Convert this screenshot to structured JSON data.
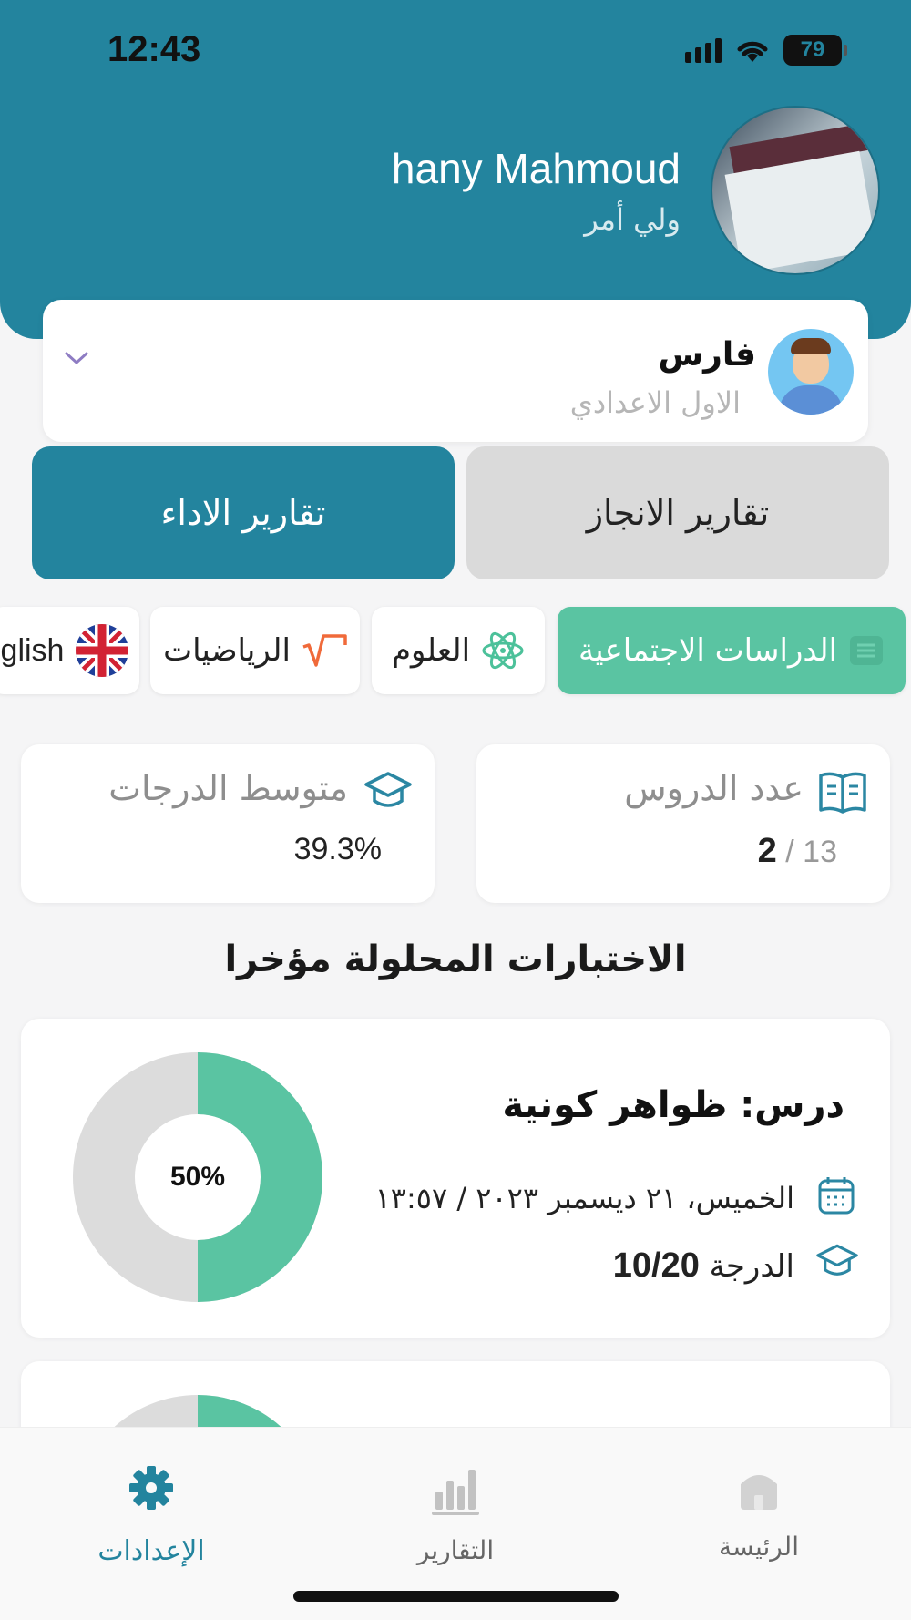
{
  "status_bar": {
    "time": "12:43",
    "battery": "79"
  },
  "profile": {
    "name": "hany Mahmoud",
    "role": "ولي أمر"
  },
  "student": {
    "name": "فارس",
    "grade": "الاول الاعدادي"
  },
  "tabs": {
    "achievement": "تقارير الانجاز",
    "performance": "تقارير الاداء"
  },
  "subjects": [
    {
      "label": "الدراسات الاجتماعية",
      "icon": "list-icon",
      "selected": true
    },
    {
      "label": "العلوم",
      "icon": "atom-icon",
      "selected": false
    },
    {
      "label": "الرياضيات",
      "icon": "sqrt-icon",
      "selected": false
    },
    {
      "label": "glish",
      "icon": "uk-flag-icon",
      "selected": false
    }
  ],
  "stats": {
    "lessons": {
      "label": "عدد الدروس",
      "done": "2",
      "total": "13",
      "sep": "/"
    },
    "average": {
      "label": "متوسط الدرجات",
      "value": "39.3%"
    }
  },
  "recent_quizzes_title": "الاختبارات المحلولة مؤخرا",
  "quizzes": [
    {
      "title": "درس: ظواهر كونية",
      "date": "الخميس، ٢١ ديسمبر ٢٠٢٣ / ١٣:٥٧",
      "grade_label": "الدرجة",
      "grade": "10/20",
      "percent_label": "50%",
      "percent": 50
    }
  ],
  "colors": {
    "primary": "#23849e",
    "accent_green": "#5ac4a2",
    "donut_gray": "#dcdcdc"
  },
  "nav": {
    "settings": "الإعدادات",
    "reports": "التقارير",
    "home": "الرئيسة"
  }
}
